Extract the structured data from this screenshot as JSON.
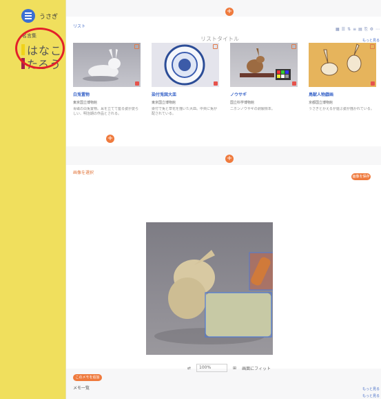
{
  "app": {
    "title": "うさぎ"
  },
  "sidebar": {
    "panel_label": "名言集",
    "users": [
      {
        "name": "はなこ",
        "color": "#f0d21a"
      },
      {
        "name": "たろう",
        "color": "#a51e4a"
      }
    ]
  },
  "list": {
    "header_label": "リスト",
    "title": "リストタイトル",
    "more_link": "もっと見る",
    "items": [
      {
        "title": "白兎置物",
        "subtitle": "東京国立博物館",
        "desc": "青磁の白兎置物。耳を立てて座る姿が愛らしい、明治期の作品とされる。"
      },
      {
        "title": "染付兎図大皿",
        "subtitle": "東京国立博物館",
        "desc": "染付で兎と草花を描いた大皿。中央に兎が配されている。"
      },
      {
        "title": "ノウサギ",
        "subtitle": "国立科学博物館",
        "desc": "ニホンノウサギの剥製標本。"
      },
      {
        "title": "鳥獣人物戯画",
        "subtitle": "京都国立博物館",
        "desc": "うさぎとかえるが遊ぶ姿が描かれている。"
      }
    ]
  },
  "viewer": {
    "label": "画像を選択",
    "save_label": "画像を保存",
    "zoom_value": "100%",
    "fit_label": "画面にフィット"
  },
  "notes": {
    "button_label": "このメモを追加",
    "label": "メモ一覧",
    "links": [
      "もっと見る",
      "もっと見る"
    ]
  }
}
